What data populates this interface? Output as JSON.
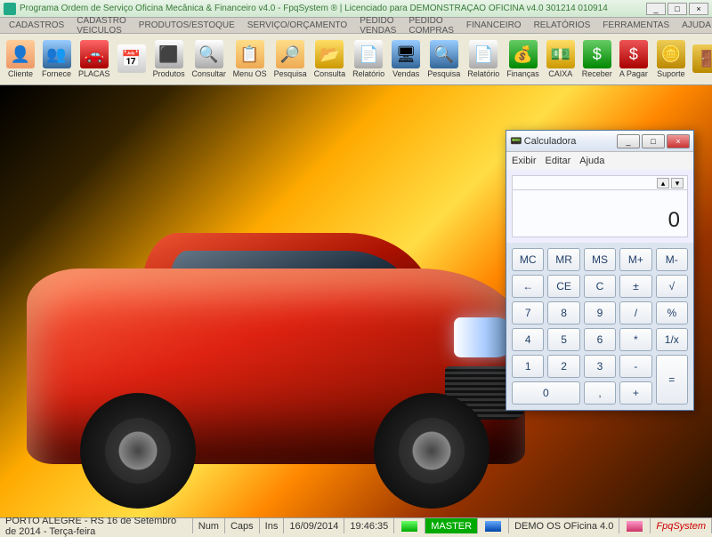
{
  "window": {
    "title": "Programa Ordem de Serviço Oficina Mecânica & Financeiro v4.0 - FpqSystem ® | Licenciado para DEMONSTRAÇÃO OFICINA v4.0 301214 010914",
    "min": "_",
    "max": "□",
    "close": "×"
  },
  "menubar": [
    "CADASTROS",
    "CADASTRO VEICULOS",
    "PRODUTOS/ESTOQUE",
    "SERVIÇO/ORÇAMENTO",
    "PEDIDO VENDAS",
    "PEDIDO COMPRAS",
    "FINANCEIRO",
    "RELATÓRIOS",
    "FERRAMENTAS",
    "AJUDA"
  ],
  "toolbar": [
    {
      "label": "Cliente",
      "glyph": "👤",
      "cls": "i1"
    },
    {
      "label": "Fornece",
      "glyph": "👥",
      "cls": "i2"
    },
    {
      "label": "PLACAS",
      "glyph": "🚗",
      "cls": "i3"
    },
    {
      "label": "",
      "glyph": "📅",
      "cls": "i4"
    },
    {
      "label": "Produtos",
      "glyph": "⬛",
      "cls": "i6"
    },
    {
      "label": "Consultar",
      "glyph": "🔍",
      "cls": "i6"
    },
    {
      "label": "Menu OS",
      "glyph": "📋",
      "cls": "i7"
    },
    {
      "label": "Pesquisa",
      "glyph": "🔎",
      "cls": "i7"
    },
    {
      "label": "Consulta",
      "glyph": "📂",
      "cls": "i5"
    },
    {
      "label": "Relatório",
      "glyph": "📄",
      "cls": "i6"
    },
    {
      "label": "Vendas",
      "glyph": "🖥",
      "cls": "i2"
    },
    {
      "label": "Pesquisa",
      "glyph": "🔍",
      "cls": "i2"
    },
    {
      "label": "Relatório",
      "glyph": "📄",
      "cls": "i6"
    },
    {
      "label": "Finanças",
      "glyph": "💰",
      "cls": "i8"
    },
    {
      "label": "CAIXA",
      "glyph": "💵",
      "cls": "i5"
    },
    {
      "label": "Receber",
      "glyph": "$",
      "cls": "i8"
    },
    {
      "label": "A Pagar",
      "glyph": "$",
      "cls": "i9"
    },
    {
      "label": "",
      "glyph": "",
      "cls": ""
    },
    {
      "label": "Suporte",
      "glyph": "🪙",
      "cls": "i10"
    },
    {
      "label": "",
      "glyph": "🚪",
      "cls": "i10"
    }
  ],
  "calculator": {
    "title": "Calculadora",
    "min": "_",
    "max": "□",
    "close": "×",
    "menu": [
      "Exibir",
      "Editar",
      "Ajuda"
    ],
    "history_up": "▴",
    "history_down": "▾",
    "display": "0",
    "keys_row1": [
      "MC",
      "MR",
      "MS",
      "M+",
      "M-"
    ],
    "keys_row2": [
      "←",
      "CE",
      "C",
      "±",
      "√"
    ],
    "keys_row3": [
      "7",
      "8",
      "9",
      "/",
      "%"
    ],
    "keys_row4": [
      "4",
      "5",
      "6",
      "*",
      "1/x"
    ],
    "keys_row5": [
      "1",
      "2",
      "3",
      "-"
    ],
    "keys_row6": [
      "0",
      ",",
      "+"
    ],
    "equals": "="
  },
  "statusbar": {
    "location": "PORTO ALEGRE - RS 16 de Setembro de 2014 - Terça-feira",
    "num": "Num",
    "caps": "Caps",
    "ins": "Ins",
    "date": "16/09/2014",
    "time": "19:46:35",
    "user": "MASTER",
    "app": "DEMO OS OFicina 4.0",
    "brand": "FpqSystem"
  }
}
